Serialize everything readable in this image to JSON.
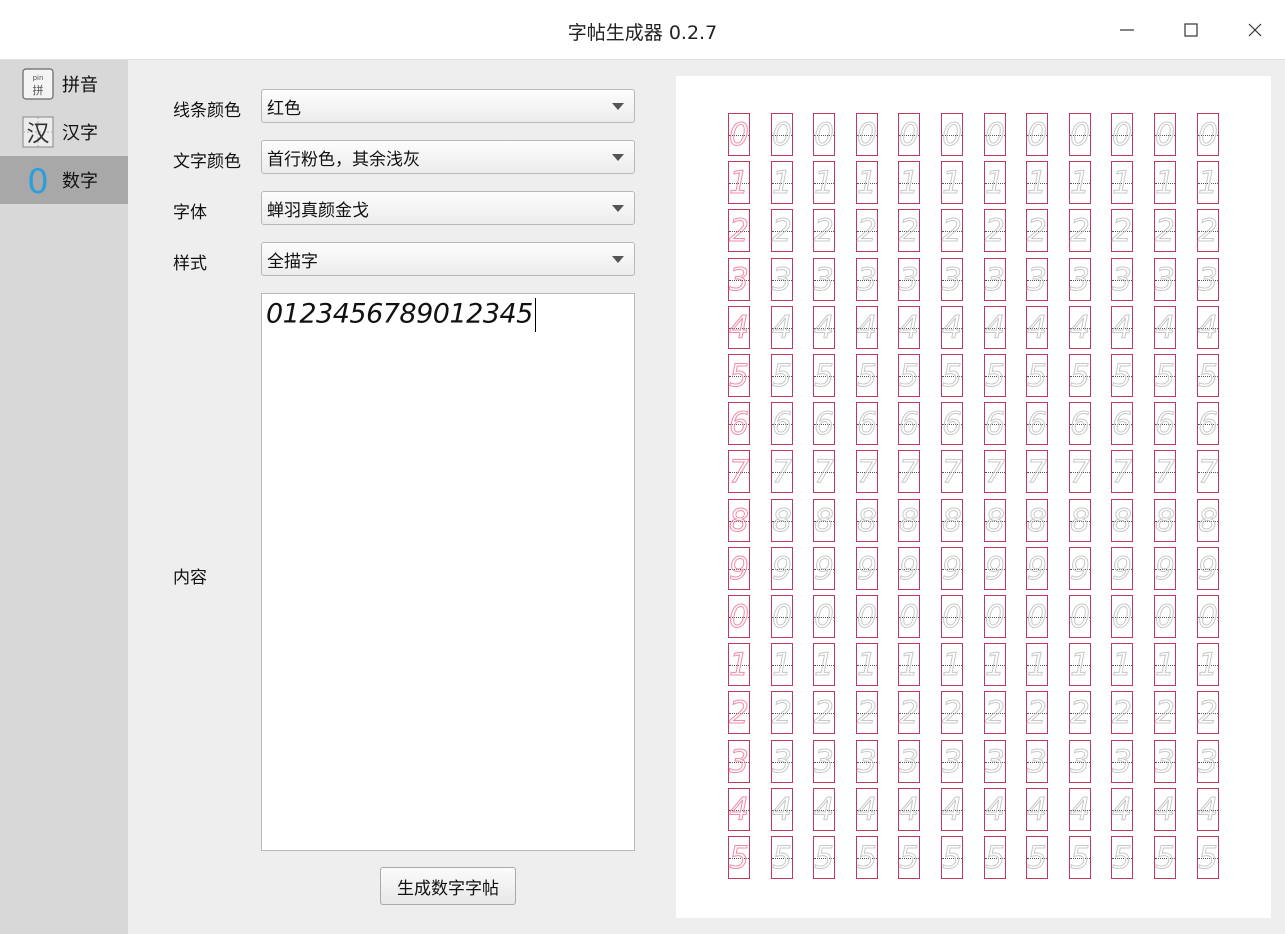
{
  "window": {
    "title": "字帖生成器 0.2.7"
  },
  "sidebar": {
    "items": [
      {
        "label": "拼音",
        "icon": "pinyin-icon",
        "icon_text_top": "pin",
        "icon_text_bottom": "拼",
        "active": false
      },
      {
        "label": "汉字",
        "icon": "hanzi-icon",
        "icon_text": "汉",
        "active": false
      },
      {
        "label": "数字",
        "icon": "digit-icon",
        "icon_text": "0",
        "active": true
      }
    ]
  },
  "form": {
    "line_color": {
      "label": "线条颜色",
      "value": "红色"
    },
    "text_color": {
      "label": "文字颜色",
      "value": "首行粉色，其余浅灰"
    },
    "font": {
      "label": "字体",
      "value": "蝉羽真颜金戈"
    },
    "style": {
      "label": "样式",
      "value": "全描字"
    },
    "content": {
      "label": "内容",
      "value": "0123456789012345"
    },
    "generate_button": "生成数字字帖"
  },
  "preview": {
    "rows": [
      "0",
      "1",
      "2",
      "3",
      "4",
      "5",
      "6",
      "7",
      "8",
      "9",
      "0",
      "1",
      "2",
      "3",
      "4",
      "5"
    ],
    "columns": 12,
    "colors": {
      "line": "#c0395a",
      "first_column_text": "#f08aa8",
      "other_text": "#c8c8c8"
    }
  }
}
